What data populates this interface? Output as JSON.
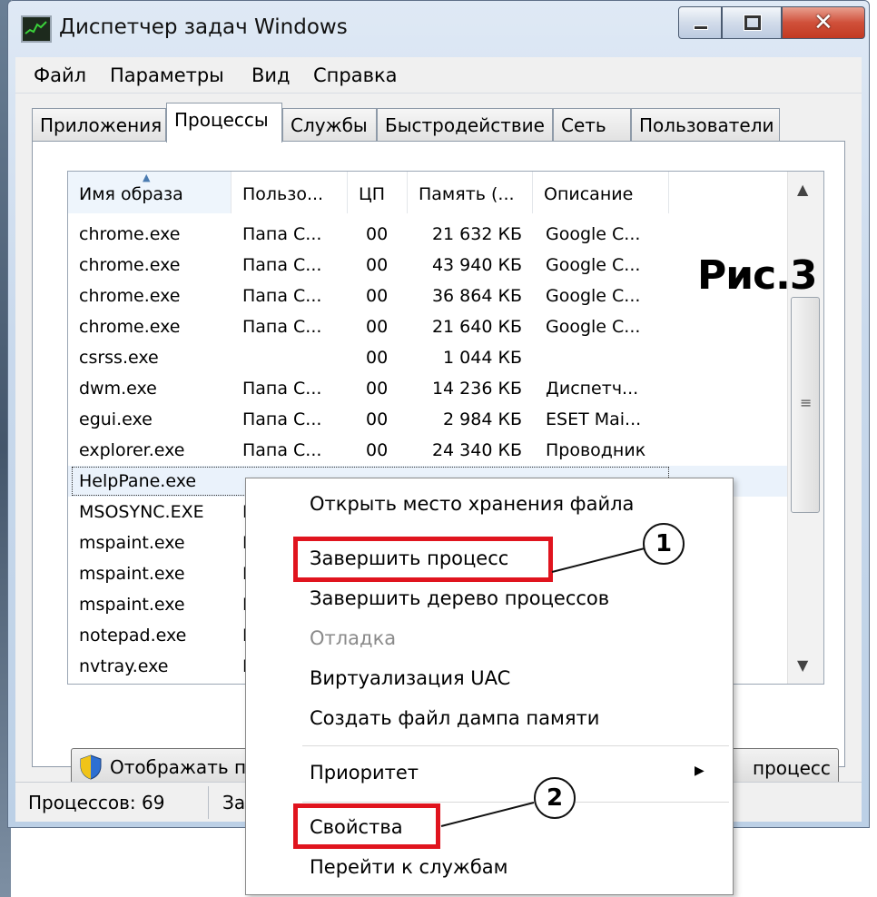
{
  "window": {
    "title": "Диспетчер задач Windows"
  },
  "menu": [
    "Файл",
    "Параметры",
    "Вид",
    "Справка"
  ],
  "tabs": [
    "Приложения",
    "Процессы",
    "Службы",
    "Быстродействие",
    "Сеть",
    "Пользователи"
  ],
  "active_tab": "Процессы",
  "columns": [
    "Имя образа",
    "Пользо...",
    "ЦП",
    "Память (...",
    "Описание"
  ],
  "rows": [
    {
      "name": "chrome.exe",
      "user": "Папа С...",
      "cpu": "00",
      "mem": "21 632 КБ",
      "desc": "Google C..."
    },
    {
      "name": "chrome.exe",
      "user": "Папа С...",
      "cpu": "00",
      "mem": "43 940 КБ",
      "desc": "Google C..."
    },
    {
      "name": "chrome.exe",
      "user": "Папа С...",
      "cpu": "00",
      "mem": "36 864 КБ",
      "desc": "Google C..."
    },
    {
      "name": "chrome.exe",
      "user": "Папа С...",
      "cpu": "00",
      "mem": "21 640 КБ",
      "desc": "Google C..."
    },
    {
      "name": "csrss.exe",
      "user": "",
      "cpu": "00",
      "mem": "1 044 КБ",
      "desc": ""
    },
    {
      "name": "dwm.exe",
      "user": "Папа С...",
      "cpu": "00",
      "mem": "14 236 КБ",
      "desc": "Диспетч..."
    },
    {
      "name": "egui.exe",
      "user": "Папа С...",
      "cpu": "00",
      "mem": "2 984 КБ",
      "desc": "ESET Mai..."
    },
    {
      "name": "explorer.exe",
      "user": "Папа С...",
      "cpu": "00",
      "mem": "24 340 КБ",
      "desc": "Проводник"
    },
    {
      "name": "HelpPane.exe",
      "user": "",
      "cpu": "",
      "mem": "",
      "desc": ""
    },
    {
      "name": "MSOSYNC.EXE",
      "user": "П",
      "cpu": "",
      "mem": "",
      "desc": ""
    },
    {
      "name": "mspaint.exe",
      "user": "П",
      "cpu": "",
      "mem": "",
      "desc": ""
    },
    {
      "name": "mspaint.exe",
      "user": "П",
      "cpu": "",
      "mem": "",
      "desc": ""
    },
    {
      "name": "mspaint.exe",
      "user": "П",
      "cpu": "",
      "mem": "",
      "desc": ""
    },
    {
      "name": "notepad.exe",
      "user": "П",
      "cpu": "",
      "mem": "",
      "desc": ""
    },
    {
      "name": "nvtray.exe",
      "user": "П",
      "cpu": "",
      "mem": "",
      "desc": ""
    }
  ],
  "buttons": {
    "show_all": "Отображать пр",
    "end_process": "процесс"
  },
  "status": {
    "processes": "Процессов: 69",
    "cpu_partial": "Заг"
  },
  "context_menu": {
    "items": [
      {
        "label": "Открыть место хранения файла",
        "enabled": true
      },
      {
        "label": "Завершить процесс",
        "enabled": true
      },
      {
        "label": "Завершить дерево процессов",
        "enabled": true
      },
      {
        "label": "Отладка",
        "enabled": false
      },
      {
        "label": "Виртуализация UAC",
        "enabled": true
      },
      {
        "label": "Создать файл дампа памяти",
        "enabled": true
      },
      {
        "label": "Приоритет",
        "enabled": true
      },
      {
        "label": "Свойства",
        "enabled": true
      },
      {
        "label": "Перейти к службам",
        "enabled": true
      }
    ]
  },
  "annotations": {
    "caption": "Рис.3",
    "callout_1": "1",
    "callout_2": "2",
    "highlight_color": "#e0141e"
  }
}
